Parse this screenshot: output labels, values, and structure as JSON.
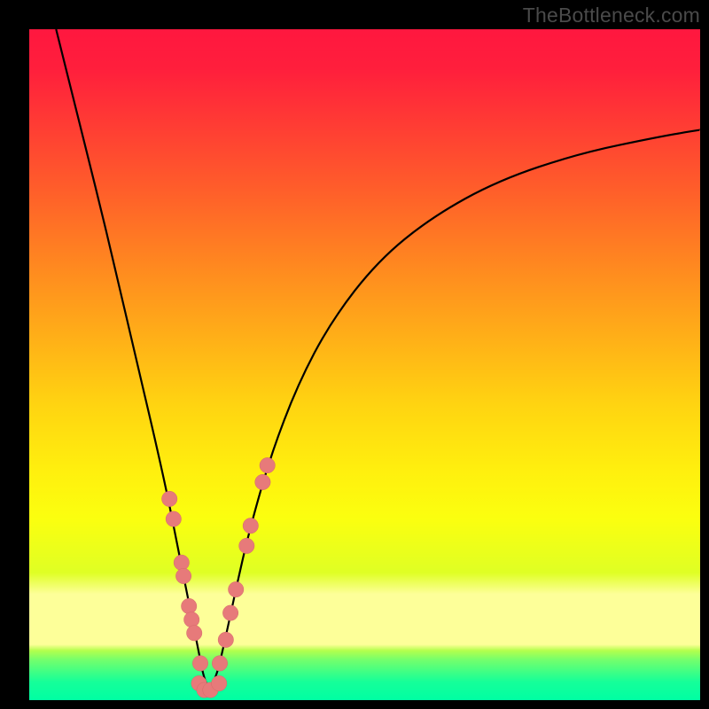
{
  "watermark": "TheBottleneck.com",
  "colors": {
    "frame": "#000000",
    "curve": "#000000",
    "marker_fill": "#e77a7a",
    "marker_stroke": "#d46a6a"
  },
  "chart_data": {
    "type": "line",
    "title": "",
    "xlabel": "",
    "ylabel": "",
    "xlim": [
      0,
      100
    ],
    "ylim": [
      0,
      100
    ],
    "grid": false,
    "legend": false,
    "note": "Coordinates are in percent of the plot area (0–100). y is measured from the bottom (0 = bottom green band, 100 = top red band). Curve is a V-shaped bottleneck profile with minimum near x≈26.",
    "series": [
      {
        "name": "bottleneck-curve",
        "x": [
          4.0,
          7.0,
          10.0,
          13.0,
          16.0,
          18.5,
          20.5,
          22.0,
          23.5,
          25.0,
          26.4,
          27.8,
          29.2,
          31.0,
          33.0,
          36.0,
          40.0,
          45.0,
          52.0,
          60.0,
          70.0,
          82.0,
          94.0,
          100.0
        ],
        "y": [
          100.0,
          88.0,
          76.0,
          63.5,
          50.5,
          40.0,
          31.0,
          23.5,
          16.0,
          8.5,
          1.5,
          3.0,
          9.0,
          17.5,
          26.0,
          36.5,
          47.0,
          56.5,
          65.5,
          72.0,
          77.5,
          81.5,
          84.0,
          85.0
        ]
      }
    ],
    "markers": {
      "name": "highlighted-points",
      "note": "Salmon dots clustered along both arms of the V near the bottom.",
      "points": [
        {
          "x": 20.9,
          "y": 30.0
        },
        {
          "x": 21.5,
          "y": 27.0
        },
        {
          "x": 22.7,
          "y": 20.5
        },
        {
          "x": 23.0,
          "y": 18.5
        },
        {
          "x": 23.8,
          "y": 14.0
        },
        {
          "x": 24.2,
          "y": 12.0
        },
        {
          "x": 24.6,
          "y": 10.0
        },
        {
          "x": 25.5,
          "y": 5.5
        },
        {
          "x": 25.3,
          "y": 2.5
        },
        {
          "x": 26.1,
          "y": 1.5
        },
        {
          "x": 27.0,
          "y": 1.5
        },
        {
          "x": 28.3,
          "y": 2.5
        },
        {
          "x": 28.4,
          "y": 5.5
        },
        {
          "x": 29.3,
          "y": 9.0
        },
        {
          "x": 30.0,
          "y": 13.0
        },
        {
          "x": 30.8,
          "y": 16.5
        },
        {
          "x": 32.4,
          "y": 23.0
        },
        {
          "x": 33.0,
          "y": 26.0
        },
        {
          "x": 34.8,
          "y": 32.5
        },
        {
          "x": 35.5,
          "y": 35.0
        }
      ],
      "radius_pct": 1.15
    }
  }
}
